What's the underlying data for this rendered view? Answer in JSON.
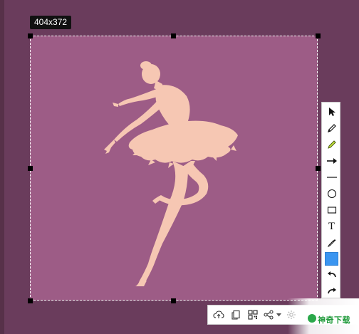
{
  "selection": {
    "size_label": "404x372"
  },
  "vertical_toolbar": {
    "tools": [
      {
        "name": "select-tool",
        "icon": "cursor-arrow-icon"
      },
      {
        "name": "pen-tool",
        "icon": "pen-icon"
      },
      {
        "name": "highlighter-tool",
        "icon": "highlighter-icon"
      },
      {
        "name": "arrow-tool",
        "icon": "arrow-right-icon"
      },
      {
        "name": "line-tool",
        "icon": "line-icon"
      },
      {
        "name": "ellipse-tool",
        "icon": "circle-icon"
      },
      {
        "name": "rectangle-tool",
        "icon": "rectangle-icon"
      },
      {
        "name": "text-tool",
        "icon": "text-icon",
        "glyph": "T"
      },
      {
        "name": "color-picker-tool",
        "icon": "eyedropper-icon"
      },
      {
        "name": "color-swatch",
        "icon": "color-swatch",
        "color": "#3a95f0"
      },
      {
        "name": "undo-tool",
        "icon": "undo-icon"
      },
      {
        "name": "redo-tool",
        "icon": "redo-icon"
      }
    ]
  },
  "bottom_toolbar": {
    "tools": [
      {
        "name": "upload-button",
        "icon": "cloud-upload-icon"
      },
      {
        "name": "copy-button",
        "icon": "copy-icon"
      },
      {
        "name": "qr-code-button",
        "icon": "qr-code-icon"
      },
      {
        "name": "share-button",
        "icon": "share-icon"
      },
      {
        "name": "share-dropdown",
        "icon": "chevron-down-icon"
      },
      {
        "name": "settings-button",
        "icon": "gear-icon"
      }
    ]
  },
  "watermark": {
    "text": "神奇下载"
  },
  "colors": {
    "desktop": "#6a3c5c",
    "capture_background": "#9d5c86",
    "dancer": "#f6c7b3",
    "accent_swatch": "#3a95f0"
  }
}
